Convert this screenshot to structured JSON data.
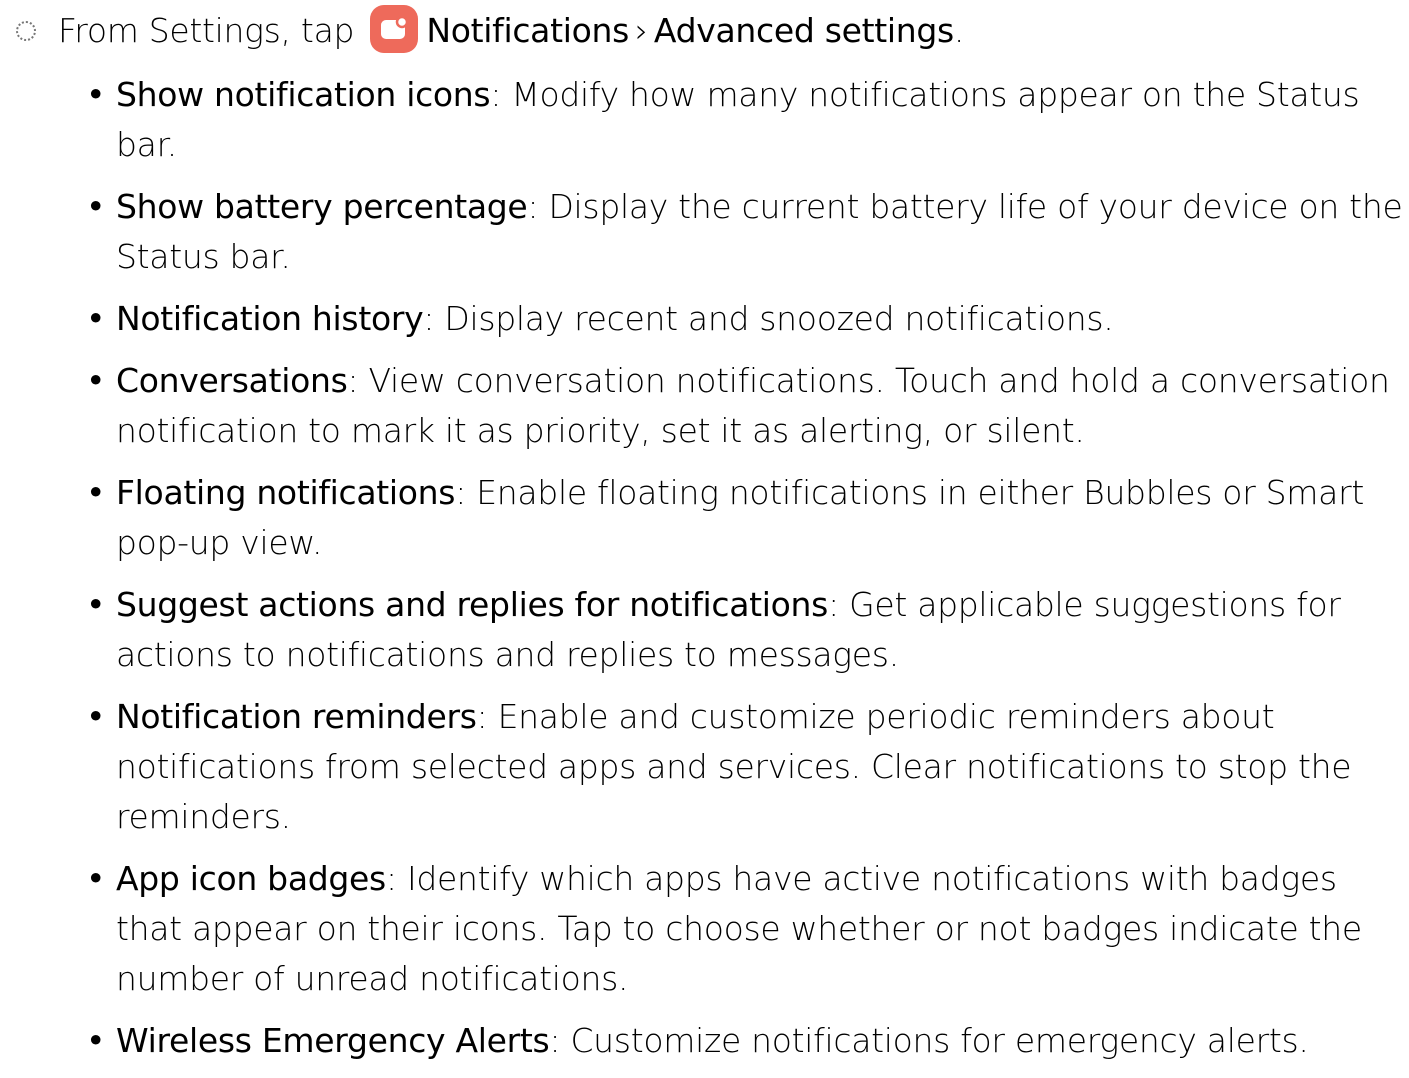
{
  "step": {
    "prefix": "From Settings, tap",
    "menu": "Notifications",
    "separator": "›",
    "submenu": "Advanced settings",
    "suffix": ".",
    "icon": "notifications-app-icon",
    "icon_color": "#ee6a5b"
  },
  "items": [
    {
      "term": "Show notification icons",
      "text": ": Modify how many notifications appear on the Status bar."
    },
    {
      "term": "Show battery percentage",
      "text": ": Display the current battery life of your device on the Status bar."
    },
    {
      "term": "Notification history",
      "text": ": Display recent and snoozed notifications."
    },
    {
      "term": "Conversations",
      "text": ": View conversation notifications. Touch and hold a conversation notification to mark it as priority, set it as alerting, or silent."
    },
    {
      "term": "Floating notifications",
      "text": ": Enable floating notifications in either Bubbles or Smart pop-up view."
    },
    {
      "term": "Suggest actions and replies for notifications",
      "text": ": Get applicable suggestions for actions to notifications and replies to messages."
    },
    {
      "term": "Notification reminders",
      "text": ": Enable and customize periodic reminders about notifications from selected apps and services. Clear notifications to stop the reminders."
    },
    {
      "term": "App icon badges",
      "text": ": Identify which apps have active notifications with badges that appear on their icons. Tap to choose whether or not badges indicate the number of unread notifications."
    },
    {
      "term": "Wireless Emergency Alerts",
      "text": ": Customize notifications for emergency alerts."
    }
  ]
}
